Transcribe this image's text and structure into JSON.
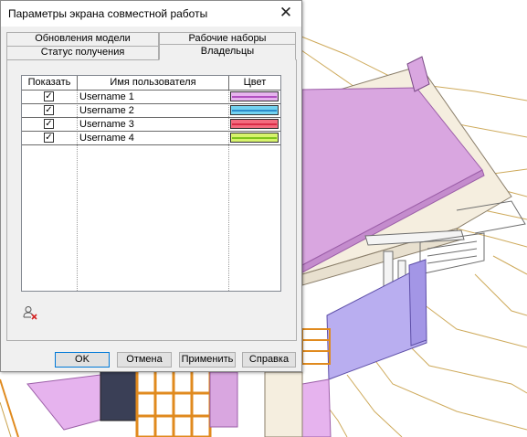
{
  "dialog": {
    "title": "Параметры экрана совместной работы",
    "close_glyph": "✕"
  },
  "tabs": [
    {
      "label": "Обновления модели"
    },
    {
      "label": "Рабочие наборы"
    },
    {
      "label": "Статус получения"
    },
    {
      "label": "Владельцы",
      "active": true
    }
  ],
  "table": {
    "headers": {
      "show": "Показать",
      "username": "Имя пользователя",
      "color": "Цвет"
    },
    "rows": [
      {
        "checked": true,
        "check_glyph": "✓",
        "username": "Username 1",
        "color": "#b14fc0",
        "fill": "#e6b3ee"
      },
      {
        "checked": true,
        "check_glyph": "✓",
        "username": "Username 2",
        "color": "#2b8ccc",
        "fill": "#73d2f0"
      },
      {
        "checked": true,
        "check_glyph": "✓",
        "username": "Username 3",
        "color": "#d82c46",
        "fill": "#f36b7e"
      },
      {
        "checked": true,
        "check_glyph": "✓",
        "username": "Username 4",
        "color": "#7fc41c",
        "fill": "#d7f36b"
      }
    ]
  },
  "icons": {
    "remove_user": "remove-user-icon"
  },
  "buttons": {
    "ok": "OK",
    "cancel": "Отмена",
    "apply": "Применить",
    "help": "Справка"
  },
  "colors": {
    "model_pink": "#d9a6e0",
    "model_lavender": "#b9aef0",
    "model_beige": "#f5eedf",
    "frame_orange": "#f4a83a"
  }
}
